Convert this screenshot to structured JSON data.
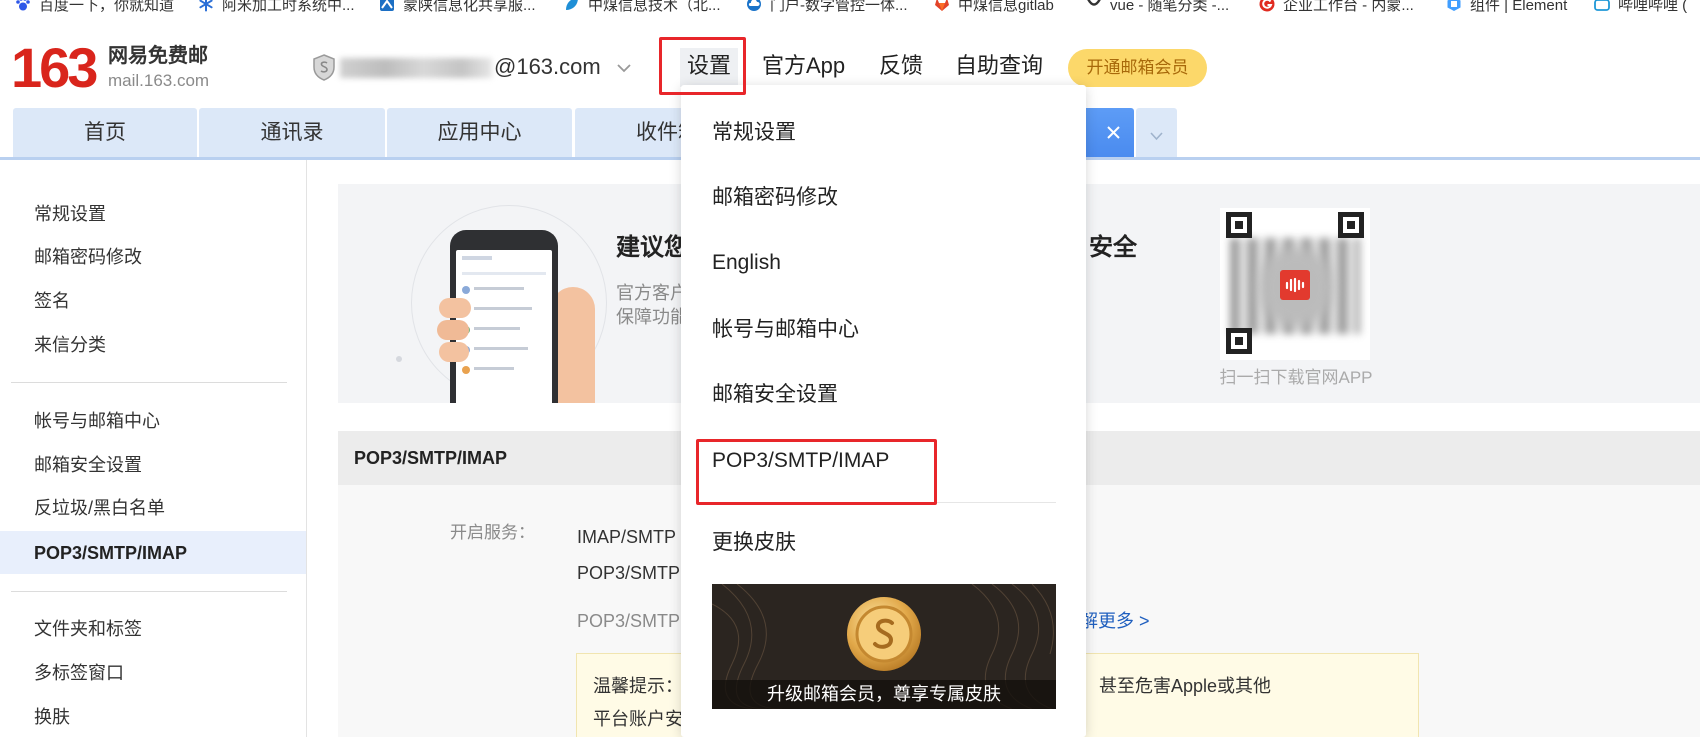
{
  "bookmarks": [
    {
      "label": "百度一下，你就知道",
      "icon": "baidu-paw-icon"
    },
    {
      "label": "阿米加工时系统中...",
      "icon": "snowflake-icon"
    },
    {
      "label": "蒙陕信息化共享服...",
      "icon": "blue-square-icon"
    },
    {
      "label": "中煤信息技术（北...",
      "icon": "leaf-icon"
    },
    {
      "label": "门户-数字管控一体...",
      "icon": "cloud-icon"
    },
    {
      "label": "中煤信息gitlab",
      "icon": "gitlab-icon"
    },
    {
      "label": "vue - 随笔分类 -...",
      "icon": "cnblogs-icon"
    },
    {
      "label": "企业工作台 - 内蒙...",
      "icon": "red-g-icon"
    },
    {
      "label": "组件 | Element",
      "icon": "element-icon"
    },
    {
      "label": "哔哩哔哩 (",
      "icon": "bilibili-icon"
    }
  ],
  "header": {
    "logo": {
      "number": "163",
      "name_cn": "网易免费邮",
      "domain": "mail.163.com"
    },
    "account": {
      "email_suffix": "@163.com",
      "icon": "shield-icon"
    },
    "nav": [
      {
        "label": "设置"
      },
      {
        "label": "官方App"
      },
      {
        "label": "反馈"
      },
      {
        "label": "自助查询"
      }
    ],
    "vip_button": "开通邮箱会员"
  },
  "tabs": [
    {
      "label": "首页"
    },
    {
      "label": "通讯录"
    },
    {
      "label": "应用中心"
    },
    {
      "label": "收件箱"
    }
  ],
  "sidebar": {
    "groups": [
      {
        "items": [
          "常规设置",
          "邮箱密码修改",
          "签名",
          "来信分类"
        ]
      },
      {
        "items": [
          "帐号与邮箱中心",
          "邮箱安全设置",
          "反垃圾/黑白名单",
          "POP3/SMTP/IMAP"
        ]
      },
      {
        "items": [
          "文件夹和标签",
          "多标签窗口",
          "换肤"
        ]
      }
    ]
  },
  "promo": {
    "headline_start": "建议您",
    "headline_end": "安全",
    "line1": "官方客户",
    "line2": "保障功能",
    "qr_caption": "扫一扫下载官网APP"
  },
  "settings": {
    "title": "POP3/SMTP/IMAP",
    "service_label": "开启服务：",
    "services": [
      "IMAP/SMTP",
      "POP3/SMTP"
    ],
    "note": "POP3/SMTP",
    "learn_more": "解更多 >",
    "tip": {
      "label": "温馨提示：",
      "line1_tail": "甚至危害Apple或其他",
      "line2": "平台账户安"
    }
  },
  "dropdown": {
    "items": [
      "常规设置",
      "邮箱密码修改",
      "English",
      "帐号与邮箱中心",
      "邮箱安全设置",
      "POP3/SMTP/IMAP"
    ],
    "skin_item": "更换皮肤",
    "skin_banner_caption": "升级邮箱会员，尊享专属皮肤"
  },
  "colors": {
    "brand_red": "#d9251c",
    "tab_bg": "#dce8f8",
    "active_tab_blue": "#4e90f2",
    "vip_yellow": "#fcd86a",
    "annotation_red": "#e8262a",
    "link_blue": "#1f5fbf",
    "selected_bg": "#e8effc"
  }
}
